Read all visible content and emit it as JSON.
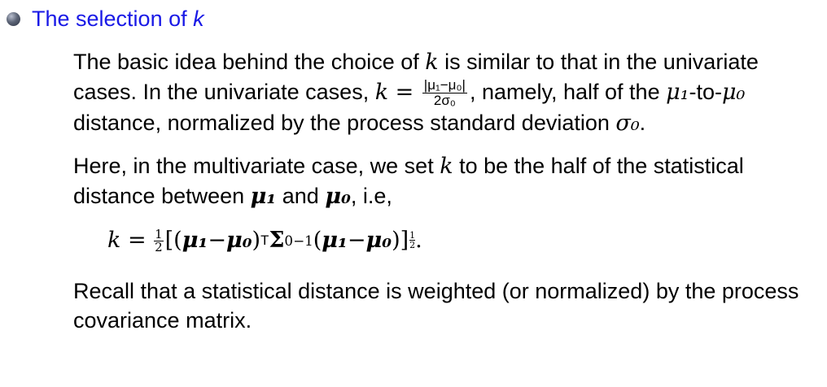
{
  "heading": {
    "prefix": "The selection of ",
    "var": "k"
  },
  "para1": {
    "t1": "The basic idea behind the choice of ",
    "k": "k",
    "t2": " is similar to that in the univariate cases. In the univariate cases, ",
    "k_eq": "k =",
    "frac_num": "|μ₁−μ₀|",
    "frac_den": "2σ₀",
    "t3": ", namely, half of the ",
    "mu1": "μ₁",
    "t4": "-to-",
    "mu0": "μ₀",
    "t5": " distance, normalized by the process standard deviation ",
    "sigma0": "σ₀",
    "t6": "."
  },
  "para2": {
    "t1": "Here, in the multivariate case, we set ",
    "k": "k",
    "t2": " to be the half of the statistical distance between ",
    "mu1": "μ₁",
    "t3": " and ",
    "mu0": "μ₀",
    "t4": ", i.e,"
  },
  "equation": {
    "lhs": "k =",
    "half_num": "1",
    "half_den": "2",
    "part1": "[(",
    "mu1a": "μ₁",
    "minus": " − ",
    "mu0a": "μ₀",
    "close_T": ")",
    "T": "T",
    "Sigma": "Σ",
    "sigma_sub": "0",
    "inv": "−1",
    "open2": "(",
    "mu1b": "μ₁",
    "mu0b": "μ₀",
    "close2": ")]",
    "exp_num": "1",
    "exp_den": "2",
    "end": "."
  },
  "para3": {
    "text": "Recall that a statistical distance is weighted (or normalized) by the process covariance matrix."
  }
}
